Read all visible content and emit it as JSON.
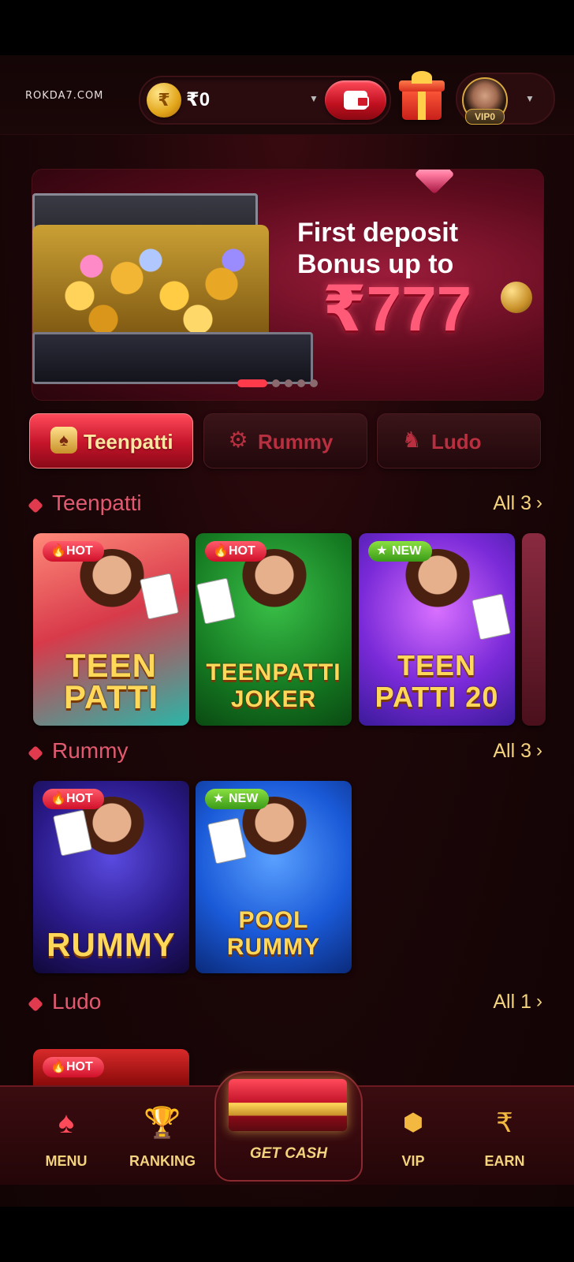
{
  "header": {
    "logo": "ROKDA7.COM",
    "currency_symbol": "₹",
    "balance": "₹0",
    "vip_level": "VIP0"
  },
  "banner": {
    "headline_line1": "First deposit",
    "headline_line2": "Bonus up to",
    "amount": "₹777",
    "slides": 5,
    "active_slide": 1
  },
  "categories": [
    {
      "label": "Teenpatti",
      "icon": "cards-icon",
      "active": true
    },
    {
      "label": "Rummy",
      "icon": "gear-icon",
      "active": false
    },
    {
      "label": "Ludo",
      "icon": "horn-icon",
      "active": false
    }
  ],
  "sections": {
    "teenpatti": {
      "title": "Teenpatti",
      "all_label": "All 3",
      "games": [
        {
          "title": "TEEN PATTI",
          "badge": "HOT"
        },
        {
          "title": "TEENPATTI JOKER",
          "badge": "HOT"
        },
        {
          "title": "TEEN PATTI 20",
          "badge": "NEW"
        }
      ]
    },
    "rummy": {
      "title": "Rummy",
      "all_label": "All 3",
      "games": [
        {
          "title": "RUMMY",
          "badge": "HOT"
        },
        {
          "title": "POOL RUMMY",
          "badge": "NEW"
        }
      ]
    },
    "ludo": {
      "title": "Ludo",
      "all_label": "All 1",
      "games": [
        {
          "title": "",
          "badge": "HOT"
        }
      ]
    }
  },
  "bottom_nav": {
    "menu": "MENU",
    "ranking": "RANKING",
    "get_cash": "GET CASH",
    "vip": "VIP",
    "earn": "EARN"
  },
  "colors": {
    "accent_red": "#d0102a",
    "gold_text": "#f3d37e",
    "section_title": "#e25a70",
    "background": "#1c0608"
  }
}
